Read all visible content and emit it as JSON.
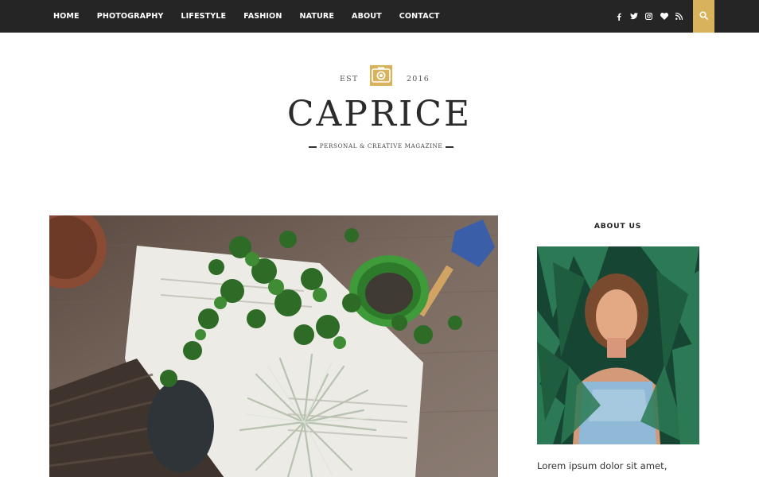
{
  "nav": {
    "items": [
      {
        "label": "HOME"
      },
      {
        "label": "PHOTOGRAPHY"
      },
      {
        "label": "LIFESTYLE"
      },
      {
        "label": "FASHION"
      },
      {
        "label": "NATURE"
      },
      {
        "label": "ABOUT"
      },
      {
        "label": "CONTACT"
      }
    ]
  },
  "social": {
    "icons": [
      "facebook-icon",
      "twitter-icon",
      "instagram-icon",
      "heart-icon",
      "rss-icon"
    ],
    "search_icon": "search-icon"
  },
  "masthead": {
    "est_left": "EST",
    "est_right": "2016",
    "logo": "CAPRICE",
    "tagline": "Personal & Creative Magazine"
  },
  "sidebar": {
    "title": "ABOUT US",
    "text": "Lorem ipsum dolor sit amet,"
  },
  "colors": {
    "nav_bg": "#252525",
    "accent": "#d8b35c",
    "text": "#2b2b2b"
  }
}
